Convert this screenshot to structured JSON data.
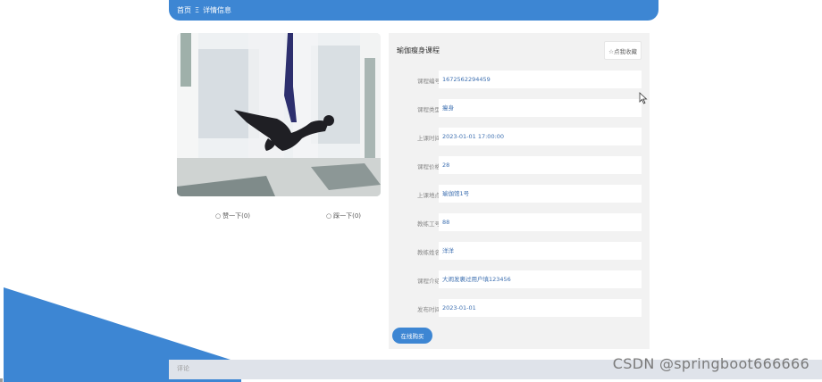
{
  "breadcrumb": {
    "home": "首页",
    "separator": "Ξ",
    "current": "详情信息"
  },
  "actions": {
    "like_label": "赞一下(0)",
    "dislike_label": "踩一下(0)"
  },
  "detail": {
    "title": "瑜伽瘦身课程",
    "collect_label": "☆点我收藏",
    "fields": [
      {
        "label": "课程编号",
        "value": "1672562294459"
      },
      {
        "label": "课程类型",
        "value": "瘦身"
      },
      {
        "label": "上课时间",
        "value": "2023-01-01 17:00:00"
      },
      {
        "label": "课程价格",
        "value": "28"
      },
      {
        "label": "上课地点",
        "value": "瑜伽馆1号"
      },
      {
        "label": "教练工号",
        "value": "88"
      },
      {
        "label": "教练姓名",
        "value": "洋洋"
      },
      {
        "label": "课程介绍",
        "value": "大闹发裹过用户填123456"
      },
      {
        "label": "发布时间",
        "value": "2023-01-01"
      }
    ],
    "buy_label": "在线购买"
  },
  "comment": {
    "label": "评论"
  },
  "watermark": "CSDN @springboot666666",
  "colors": {
    "accent": "#3d86d3",
    "panel_bg": "#f2f2f2",
    "value_text": "#3d6fb0"
  },
  "icons": {
    "like": "thumb-up-icon",
    "dislike": "thumb-down-icon",
    "collect": "star-icon"
  }
}
